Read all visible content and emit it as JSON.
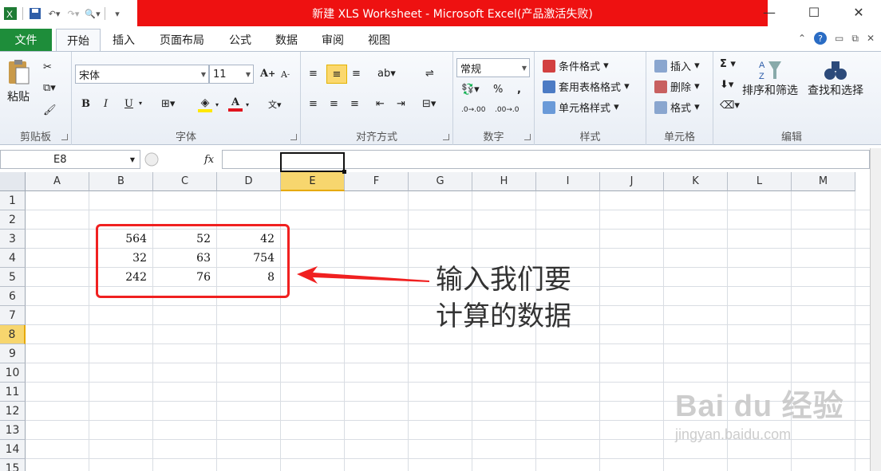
{
  "window": {
    "title": "新建 XLS Worksheet - Microsoft Excel(产品激活失败)",
    "minimize": "—",
    "maximize": "☐",
    "close": "✕"
  },
  "tabs": {
    "file": "文件",
    "items": [
      "开始",
      "插入",
      "页面布局",
      "公式",
      "数据",
      "审阅",
      "视图"
    ],
    "active": "开始"
  },
  "ribbon": {
    "clipboard": {
      "label": "剪贴板",
      "paste": "粘贴"
    },
    "font": {
      "label": "字体",
      "name": "宋体",
      "size": "11",
      "bold": "B",
      "italic": "I",
      "underline": "U"
    },
    "alignment": {
      "label": "对齐方式"
    },
    "number": {
      "label": "数字",
      "format": "常规",
      "percent": "%",
      "comma": ","
    },
    "styles": {
      "label": "样式",
      "conditional": "条件格式",
      "table": "套用表格格式",
      "cell": "单元格样式"
    },
    "cells": {
      "label": "单元格",
      "insert": "插入",
      "delete": "删除",
      "format": "格式"
    },
    "editing": {
      "label": "编辑",
      "sort": "排序和筛选",
      "find": "查找和选择",
      "sum": "Σ"
    }
  },
  "formula_bar": {
    "name_box": "E8",
    "fx": "fx",
    "content": ""
  },
  "sheet": {
    "columns": [
      "A",
      "B",
      "C",
      "D",
      "E",
      "F",
      "G",
      "H",
      "I",
      "J",
      "K",
      "L",
      "M"
    ],
    "rows": [
      "1",
      "2",
      "3",
      "4",
      "5",
      "6",
      "7",
      "8",
      "9",
      "10",
      "11",
      "12",
      "13",
      "14",
      "15"
    ],
    "selected_cell": "E8",
    "data": [
      {
        "row": "3",
        "B": "564",
        "C": "52",
        "D": "42"
      },
      {
        "row": "4",
        "B": "32",
        "C": "63",
        "D": "754"
      },
      {
        "row": "5",
        "B": "242",
        "C": "76",
        "D": "8"
      }
    ]
  },
  "annotation": {
    "line1": "输入我们要",
    "line2": "计算的数据",
    "color": "#f02020"
  },
  "watermark": {
    "brand": "Bai du 经验",
    "url": "jingyan.baidu.com"
  }
}
